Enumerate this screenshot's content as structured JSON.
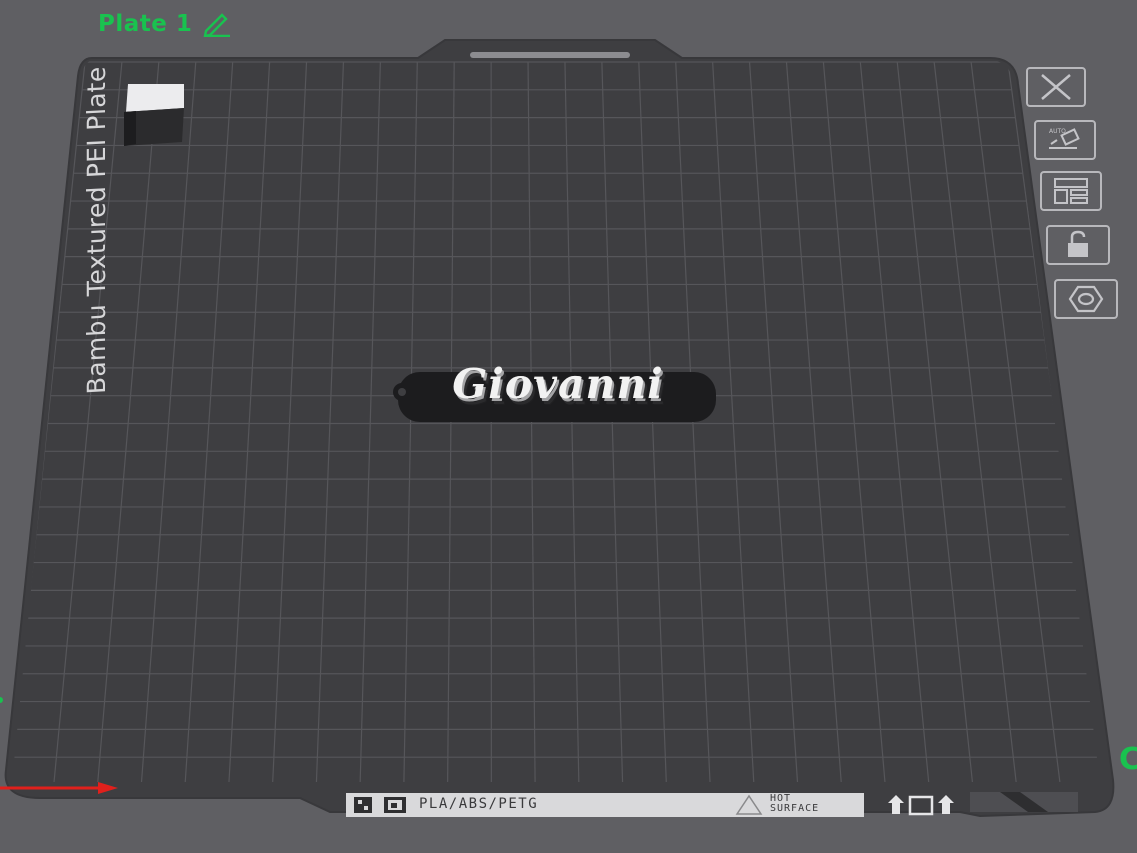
{
  "plate": {
    "title": "Plate 1",
    "label": "Bambu Textured PEI Plate"
  },
  "model": {
    "name": "Giovanni"
  },
  "bottom_strip": {
    "materials": "PLA/ABS/PETG",
    "warning_line1": "HOT",
    "warning_line2": "SURFACE"
  },
  "corner_badge": "C",
  "colors": {
    "accent": "#19c24f",
    "background": "#5f5f63",
    "plate": "#3e3e41",
    "grid": "#56565a",
    "x_axis": "#e0201c"
  },
  "side_tools": [
    {
      "name": "close-button",
      "icon": "close-icon"
    },
    {
      "name": "auto-orient-button",
      "icon": "auto-orient-icon"
    },
    {
      "name": "arrange-button",
      "icon": "arrange-icon"
    },
    {
      "name": "lock-button",
      "icon": "lock-open-icon"
    },
    {
      "name": "plate-settings-button",
      "icon": "hex-nut-icon"
    }
  ]
}
